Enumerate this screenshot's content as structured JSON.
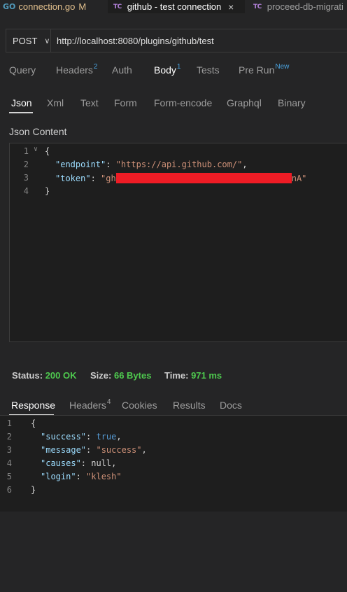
{
  "editor_tabs": [
    {
      "icon": "go-icon",
      "label": "connection.go",
      "badge": "M"
    },
    {
      "icon": "tc-icon",
      "label": "github - test connection",
      "close": "×"
    },
    {
      "icon": "tc-icon",
      "label": "proceed-db-migrati"
    }
  ],
  "icons": {
    "go": "GO",
    "tc": "TC"
  },
  "request": {
    "method": "POST",
    "url": "http://localhost:8080/plugins/github/test"
  },
  "request_tabs": {
    "query": "Query",
    "headers": "Headers",
    "headers_count": "2",
    "auth": "Auth",
    "body": "Body",
    "body_count": "1",
    "tests": "Tests",
    "pre_run": "Pre Run",
    "pre_run_badge": "New"
  },
  "body_tabs": {
    "json": "Json",
    "xml": "Xml",
    "text": "Text",
    "form": "Form",
    "form_encode": "Form-encode",
    "graphql": "Graphql",
    "binary": "Binary"
  },
  "json_content_label": "Json Content",
  "json_lines": {
    "n1": "1",
    "n2": "2",
    "n3": "3",
    "n4": "4",
    "open": "{",
    "endpoint_key": "\"endpoint\"",
    "endpoint_val": "\"https://api.github.com/\"",
    "token_key": "\"token\"",
    "token_prefix": "\"gh",
    "token_suffix": "nA\"",
    "close": "}"
  },
  "status": {
    "status_label": "Status:",
    "status_value": "200 OK",
    "size_label": "Size:",
    "size_value": "66 Bytes",
    "time_label": "Time:",
    "time_value": "971 ms"
  },
  "response_tabs": {
    "response": "Response",
    "headers": "Headers",
    "headers_count": "4",
    "cookies": "Cookies",
    "results": "Results",
    "docs": "Docs"
  },
  "response_lines": {
    "n1": "1",
    "n2": "2",
    "n3": "3",
    "n4": "4",
    "n5": "5",
    "n6": "6",
    "open": "{",
    "success_key": "\"success\"",
    "success_val": "true",
    "message_key": "\"message\"",
    "message_val": "\"success\"",
    "causes_key": "\"causes\"",
    "causes_val": "null",
    "login_key": "\"login\"",
    "login_val": "\"klesh\"",
    "close": "}"
  },
  "colors": {
    "accent": "#4aa3df",
    "success": "#4ec94e",
    "redaction": "#ee1c25"
  }
}
